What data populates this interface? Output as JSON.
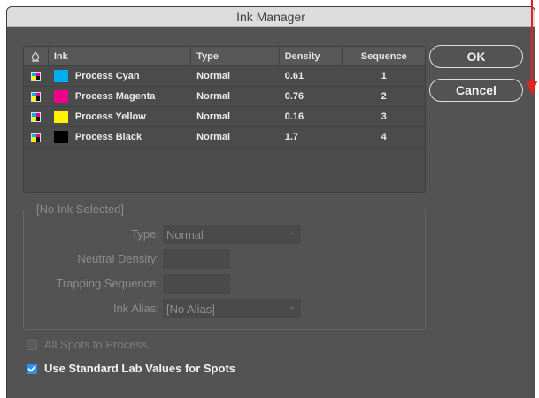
{
  "window": {
    "title": "Ink Manager"
  },
  "table": {
    "headers": {
      "ink": "Ink",
      "type": "Type",
      "density": "Density",
      "sequence": "Sequence"
    },
    "rows": [
      {
        "ink": "Process Cyan",
        "type": "Normal",
        "density": "0.61",
        "sequence": "1",
        "color": "#00aeef"
      },
      {
        "ink": "Process Magenta",
        "type": "Normal",
        "density": "0.76",
        "sequence": "2",
        "color": "#ec008c"
      },
      {
        "ink": "Process Yellow",
        "type": "Normal",
        "density": "0.16",
        "sequence": "3",
        "color": "#fff200"
      },
      {
        "ink": "Process Black",
        "type": "Normal",
        "density": "1.7",
        "sequence": "4",
        "color": "#000000"
      }
    ]
  },
  "buttons": {
    "ok": "OK",
    "cancel": "Cancel"
  },
  "selection_group": {
    "legend": "[No Ink Selected]",
    "type_label": "Type:",
    "type_value": "Normal",
    "neutral_density_label": "Neutral Density:",
    "neutral_density_value": "",
    "trapping_sequence_label": "Trapping Sequence:",
    "trapping_sequence_value": "",
    "ink_alias_label": "Ink Alias:",
    "ink_alias_value": "[No Alias]"
  },
  "options": {
    "all_spots_to_process": {
      "label": "All Spots to Process",
      "checked": false
    },
    "use_standard_lab": {
      "label": "Use Standard Lab Values for Spots",
      "checked": true
    }
  },
  "colors": {
    "accent": "#2d8ff5",
    "annotation": "#e8201e",
    "dialog_bg": "#535353"
  },
  "icons": {
    "header": "ink-drop-icon",
    "row": "process-ink-icon",
    "dropdown": "chevron-down-icon",
    "check": "checkmark-icon"
  }
}
